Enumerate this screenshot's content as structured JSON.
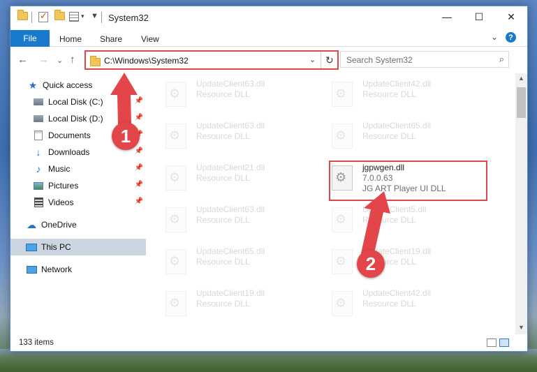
{
  "window": {
    "title": "System32",
    "controls": {
      "minimize": "—",
      "maximize": "☐",
      "close": "✕"
    }
  },
  "ribbon": {
    "tabs": [
      "File",
      "Home",
      "Share",
      "View"
    ],
    "help": "?",
    "collapse": "⌄"
  },
  "nav": {
    "back": "←",
    "forward": "→",
    "recent": "⌄",
    "up": "↑",
    "address": "C:\\Windows\\System32",
    "address_dropdown": "⌄",
    "refresh": "↻",
    "search_placeholder": "Search System32",
    "search_icon": "⌕"
  },
  "sidebar": {
    "items": [
      {
        "label": "Quick access",
        "icon": "star-icon",
        "pinned": false
      },
      {
        "label": "Local Disk (C:)",
        "icon": "drive-icon",
        "pinned": true
      },
      {
        "label": "Local Disk (D:)",
        "icon": "drive-icon",
        "pinned": true
      },
      {
        "label": "Documents",
        "icon": "document-icon",
        "pinned": true
      },
      {
        "label": "Downloads",
        "icon": "download-icon",
        "pinned": true
      },
      {
        "label": "Music",
        "icon": "music-icon",
        "pinned": true
      },
      {
        "label": "Pictures",
        "icon": "pictures-icon",
        "pinned": true
      },
      {
        "label": "Videos",
        "icon": "videos-icon",
        "pinned": true
      },
      {
        "label": "OneDrive",
        "icon": "cloud-icon",
        "pinned": false
      },
      {
        "label": "This PC",
        "icon": "computer-icon",
        "pinned": false,
        "selected": true
      },
      {
        "label": "Network",
        "icon": "network-icon",
        "pinned": false
      }
    ],
    "pin_glyph": "📌"
  },
  "files": {
    "left_column": [
      {
        "name": "UpdateClient63.dll",
        "type": "Resource DLL"
      },
      {
        "name": "UpdateClient63.dll",
        "type": "Resource DLL"
      },
      {
        "name": "UpdateClient21.dll",
        "type": "Resource DLL"
      },
      {
        "name": "UpdateClient63.dll",
        "type": "Resource DLL"
      },
      {
        "name": "UpdateClient65.dll",
        "type": "Resource DLL"
      },
      {
        "name": "UpdateClient19.dll",
        "type": "Resource DLL"
      }
    ],
    "right_column": [
      {
        "name": "UpdateClient42.dll",
        "type": "Resource DLL"
      },
      {
        "name": "UpdateClient65.dll",
        "type": "Resource DLL"
      },
      {
        "name": "UpdateClient5.dll",
        "type": "Resource DLL"
      },
      {
        "name": "UpdateClient19.dll",
        "type": "Resource DLL"
      },
      {
        "name": "UpdateClient42.dll",
        "type": "Resource DLL"
      }
    ],
    "target": {
      "name": "jgpwgen.dll",
      "version": "7.0.0.63",
      "description": "JG ART Player UI DLL"
    }
  },
  "statusbar": {
    "item_count": "133 items"
  },
  "annotations": {
    "step1": "1",
    "step2": "2",
    "color": "#e2454a"
  }
}
